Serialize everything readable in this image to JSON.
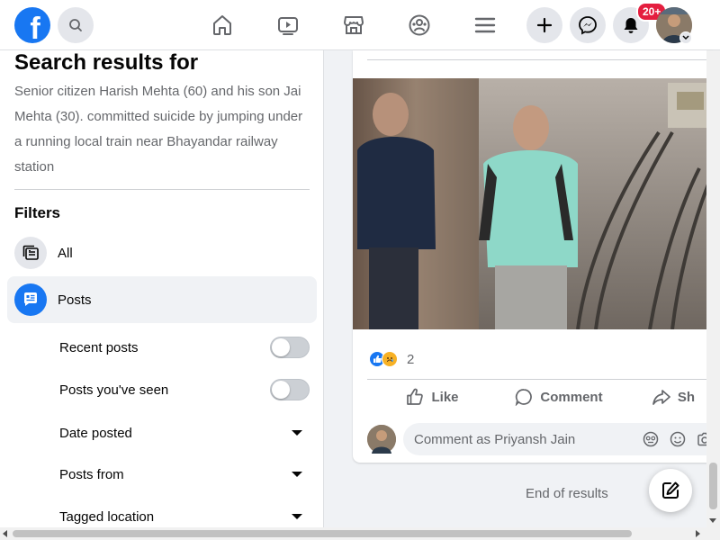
{
  "header": {
    "logo_letter": "f",
    "notifications_badge": "20+",
    "nav_icons": [
      "home-icon",
      "watch-icon",
      "marketplace-icon",
      "groups-icon",
      "menu-icon"
    ],
    "right_icons": [
      "create-icon",
      "messenger-icon",
      "notifications-icon",
      "account-avatar"
    ],
    "accent_color": "#1877f2"
  },
  "sidebar": {
    "title": "Search results for",
    "query": "Senior citizen Harish Mehta (60) and his son Jai Mehta (30). committed suicide by jumping under a running local train near Bhayandar railway station",
    "filters_title": "Filters",
    "filters": [
      {
        "label": "All",
        "icon": "all-results-icon",
        "active": false
      },
      {
        "label": "Posts",
        "icon": "posts-icon",
        "active": true
      }
    ],
    "post_options": [
      {
        "label": "Recent posts",
        "control": "toggle",
        "on": false
      },
      {
        "label": "Posts you've seen",
        "control": "toggle",
        "on": false
      },
      {
        "label": "Date posted",
        "control": "dropdown"
      },
      {
        "label": "Posts from",
        "control": "dropdown"
      },
      {
        "label": "Tagged location",
        "control": "dropdown"
      }
    ]
  },
  "post": {
    "reaction_count": "2",
    "reaction_icons": [
      "like-reaction-icon",
      "sad-reaction-icon"
    ],
    "actions": {
      "like": "Like",
      "comment": "Comment",
      "share": "Sh"
    },
    "comment_placeholder": "Comment as Priyansh Jain"
  },
  "end_of_results": "End of results"
}
